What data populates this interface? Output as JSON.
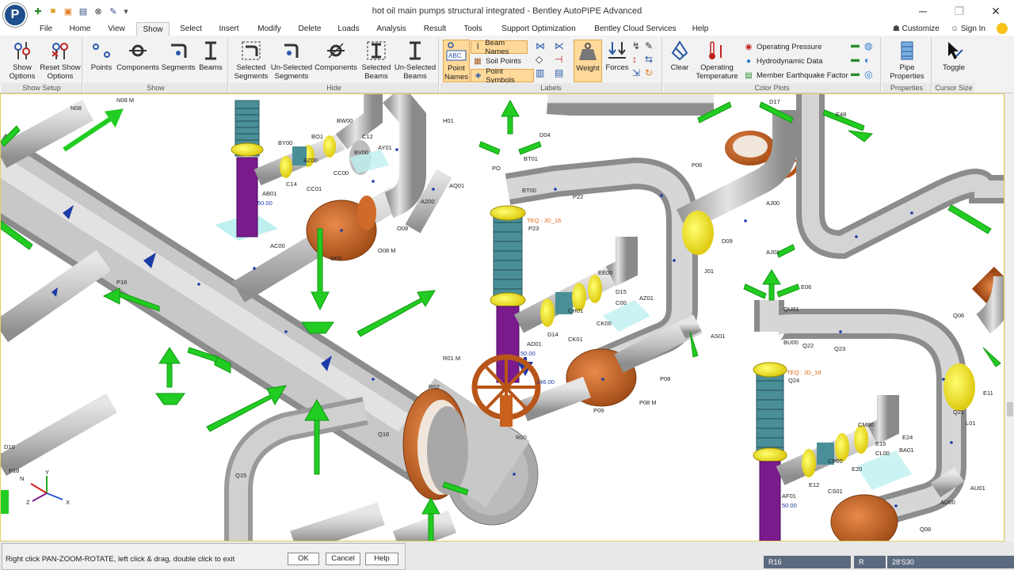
{
  "app": {
    "title": "hot oil main pumps structural integrated - Bentley AutoPIPE Advanced",
    "logo_glyph": "P"
  },
  "window_controls": {
    "minimize": "─",
    "restore": "❐",
    "close": "✕"
  },
  "tabs": [
    "File",
    "Home",
    "View",
    "Show",
    "Select",
    "Insert",
    "Modify",
    "Delete",
    "Loads",
    "Analysis",
    "Result",
    "Tools",
    "Support Optimization",
    "Bentley Cloud Services",
    "Help"
  ],
  "active_tab": "Show",
  "right_tabs": {
    "customize": "Customize",
    "sign_in": "Sign In"
  },
  "ribbon": {
    "show_setup": {
      "label": "Show Setup",
      "show_options": "Show Options",
      "reset_show_options": "Reset Show Options"
    },
    "show": {
      "label": "Show",
      "points": "Points",
      "components": "Components",
      "segments": "Segments",
      "beams": "Beams"
    },
    "hide": {
      "label": "Hide",
      "selected_segments": "Selected Segments",
      "unselected_segments": "Un-Selected Segments",
      "components": "Components",
      "selected_beams": "Selected Beams",
      "unselected_beams": "Un-Selected Beams"
    },
    "labels": {
      "label": "Labels",
      "point_names": "Point Names",
      "beam_names": "Beam Names",
      "soil_points": "Soil Points",
      "point_symbols": "Point Symbols",
      "weight": "Weight",
      "forces": "Forces"
    },
    "color_plots": {
      "label": "Color Plots",
      "clear": "Clear",
      "operating_temperature": "Operating Temperature",
      "operating_pressure": "Operating Pressure",
      "hydrodynamic_data": "Hydrodynamic Data",
      "member_earthquake_factor": "Member Earthquake Factor"
    },
    "properties": {
      "label": "Properties",
      "pipe_properties": "Pipe Properties"
    },
    "cursor_size": {
      "label": "Cursor Size",
      "toggle": "Toggle"
    }
  },
  "model_labels": {
    "n08m": "N08 M",
    "n08": "N08",
    "h01": "H01",
    "c12": "C12",
    "ay01": "AY01",
    "bw00": "BW00",
    "by00": "BY00",
    "bz00": "BZ00",
    "bo1": "BO1",
    "bv00": "BV00",
    "cc00": "CC00",
    "c14": "C14",
    "cc01": "CC01",
    "ab01": "AB01",
    "v50a": "50.00",
    "aq01": "AQ01",
    "a200": "A200",
    "o08": "O08",
    "o08m": "O08 M",
    "ac00": "AC00",
    "o00": "O00",
    "p16": "P16",
    "d04": "D04",
    "bt01": "BT01",
    "bt00": "BT00",
    "p22": "P22",
    "teq16": "TEQ : JD_16",
    "p23": "P23",
    "po": "PO",
    "ee00": "EE00",
    "d15": "D15",
    "az01": "AZ01",
    "c00": "C00",
    "ch01": "CH01",
    "d14": "D14",
    "ck01": "CK01",
    "ck00": "CK00",
    "r01m": "R01 M",
    "ad01": "AD01",
    "v50b": "50.00",
    "v146": "146.00",
    "r02": "R02",
    "r00": "R00",
    "p08": "P08",
    "p08m": "P08 M",
    "as01": "AS01",
    "q16": "Q16",
    "q15": "Q15",
    "p09": "P09",
    "p06": "P06",
    "aj00": "AJ00",
    "aj01": "AJ01",
    "d09": "D09",
    "j01": "J01",
    "e06": "E06",
    "q01": "QU01",
    "bu00": "BU00",
    "q22": "Q22",
    "q23": "Q23",
    "teq18": "TEQ : JD_18",
    "q24": "Q24",
    "q06": "Q06",
    "e11": "E11",
    "l01": "L01",
    "q21": "Q21",
    "cm00": "CM00",
    "e15": "E15",
    "e24": "E24",
    "ba01": "BA01",
    "cp00": "CP00",
    "e12": "E12",
    "cs01": "CS01",
    "af01": "AF01",
    "v50c": "50.00",
    "au01": "AU01",
    "q08": "Q08",
    "e20": "E20",
    "cl00": "CL00",
    "d10": "D10",
    "p18": "P18",
    "d17": "D17",
    "e48": "E48",
    "au00": "AU00"
  },
  "axes": {
    "x": "X",
    "y": "Y",
    "z": "Z",
    "n": "N"
  },
  "status": {
    "prompt": "Right click PAN-ZOOM-ROTATE, left click & drag, double click to exit",
    "ok": "OK",
    "cancel": "Cancel",
    "help": "Help",
    "point": "R16",
    "segment": "R",
    "length": "28'S30"
  },
  "colors": {
    "pipe": "#c4c4c4",
    "support": "#2ecc2e",
    "valve": "#c8601e",
    "flange": "#f4e400",
    "nozzle": "#7a1b8c",
    "bellows": "#4a8f98",
    "highlight": "#ffd999"
  }
}
